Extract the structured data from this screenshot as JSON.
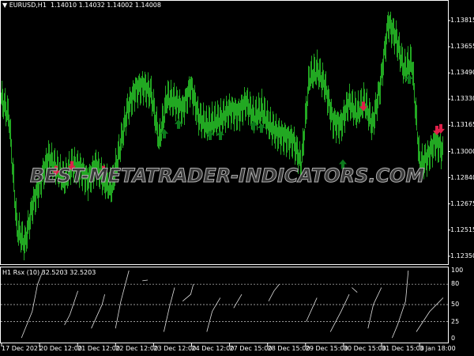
{
  "header": {
    "symbol": "EURUSD,H1",
    "ohlc": "1.14010 1.14032 1.14002 1.14008"
  },
  "indicator": {
    "title": "H1  Rsx (10) 32.5203 32.5203",
    "levels": [
      "100",
      "80",
      "50",
      "25",
      "0"
    ]
  },
  "watermark": "BEST-METATRADER-INDICATORS.COM",
  "price_axis": [
    "1.13815",
    "1.13655",
    "1.13490",
    "1.13330",
    "1.13165",
    "1.13000",
    "1.12840",
    "1.12675",
    "1.12515",
    "1.12350"
  ],
  "time_axis": [
    "17 Dec 2021",
    "20 Dec 12:00",
    "21 Dec 12:00",
    "22 Dec 12:00",
    "23 Dec 12:00",
    "24 Dec 12:00",
    "27 Dec 15:00",
    "28 Dec 15:00",
    "29 Dec 15:00",
    "30 Dec 15:00",
    "31 Dec 15:00",
    "3 Jan 18:00"
  ],
  "colors": {
    "bars": "#22a822",
    "up_arrow": "#0c7a1c",
    "down_arrow": "#e0204a",
    "indicator": "#e0e0e0"
  },
  "closes": [
    1.13327,
    1.13204,
    1.12513,
    1.12415,
    1.12661,
    1.12809,
    1.12957,
    1.12883,
    1.12809,
    1.12908,
    1.12883,
    1.12809,
    1.12908,
    1.12809,
    1.1276,
    1.13006,
    1.13253,
    1.13376,
    1.13401,
    1.13352,
    1.13056,
    1.13327,
    1.13302,
    1.13253,
    1.13401,
    1.13204,
    1.13154,
    1.13179,
    1.13204,
    1.13253,
    1.13228,
    1.13302,
    1.13204,
    1.13253,
    1.13154,
    1.13105,
    1.1308,
    1.13056,
    1.12908,
    1.1345,
    1.13499,
    1.13401,
    1.13179,
    1.13154,
    1.13302,
    1.13228,
    1.13302,
    1.13154,
    1.13401,
    1.13795,
    1.13697,
    1.13499,
    1.13549,
    1.12908,
    1.12957,
    1.13056,
    1.12982
  ],
  "arrows": [
    {
      "type": "down",
      "i": 7,
      "price": 1.1288
    },
    {
      "type": "down",
      "i": 9,
      "price": 1.1291
    },
    {
      "type": "down",
      "i": 13,
      "price": 1.1288
    },
    {
      "type": "up",
      "i": 20.7,
      "price": 1.1311
    },
    {
      "type": "up",
      "i": 22.5,
      "price": 1.1317
    },
    {
      "type": "up",
      "i": 26.5,
      "price": 1.131
    },
    {
      "type": "up",
      "i": 27.8,
      "price": 1.131
    },
    {
      "type": "up",
      "i": 32,
      "price": 1.1316
    },
    {
      "type": "up",
      "i": 33,
      "price": 1.13145
    },
    {
      "type": "up",
      "i": 43.3,
      "price": 1.1292
    },
    {
      "type": "up",
      "i": 51.7,
      "price": 1.1345
    },
    {
      "type": "down",
      "i": 45.9,
      "price": 1.1328
    },
    {
      "type": "down",
      "i": 55.2,
      "price": 1.1313
    },
    {
      "type": "down",
      "i": 55.7,
      "price": 1.1314
    }
  ],
  "rsx_segments": [
    [
      [
        8,
        1
      ],
      [
        12,
        40
      ],
      [
        14,
        80
      ],
      [
        16,
        100
      ]
    ],
    [
      [
        24,
        20
      ],
      [
        26,
        35
      ],
      [
        29,
        70
      ]
    ],
    [
      [
        34,
        15
      ],
      [
        38,
        50
      ],
      [
        39,
        65
      ]
    ],
    [
      [
        43,
        15
      ],
      [
        45,
        55
      ],
      [
        48,
        100
      ]
    ],
    [
      [
        53,
        85
      ],
      [
        55,
        86
      ]
    ],
    [
      [
        61,
        10
      ],
      [
        63,
        45
      ],
      [
        65,
        75
      ]
    ],
    [
      [
        68,
        55
      ],
      [
        71,
        65
      ],
      [
        72,
        80
      ]
    ],
    [
      [
        77,
        10
      ],
      [
        79,
        40
      ],
      [
        82,
        60
      ]
    ],
    [
      [
        87,
        45
      ],
      [
        90,
        65
      ]
    ],
    [
      [
        100,
        55
      ],
      [
        102,
        70
      ],
      [
        104,
        80
      ]
    ],
    [
      [
        114,
        25
      ],
      [
        118,
        60
      ]
    ],
    [
      [
        123,
        10
      ],
      [
        127,
        40
      ],
      [
        130,
        65
      ]
    ],
    [
      [
        131,
        75
      ],
      [
        133,
        68
      ]
    ],
    [
      [
        137,
        15
      ],
      [
        139,
        50
      ],
      [
        142,
        75
      ]
    ],
    [
      [
        146,
        1
      ],
      [
        148,
        20
      ],
      [
        151,
        55
      ],
      [
        152,
        100
      ]
    ],
    [
      [
        155,
        10
      ],
      [
        160,
        40
      ],
      [
        165,
        60
      ]
    ]
  ]
}
